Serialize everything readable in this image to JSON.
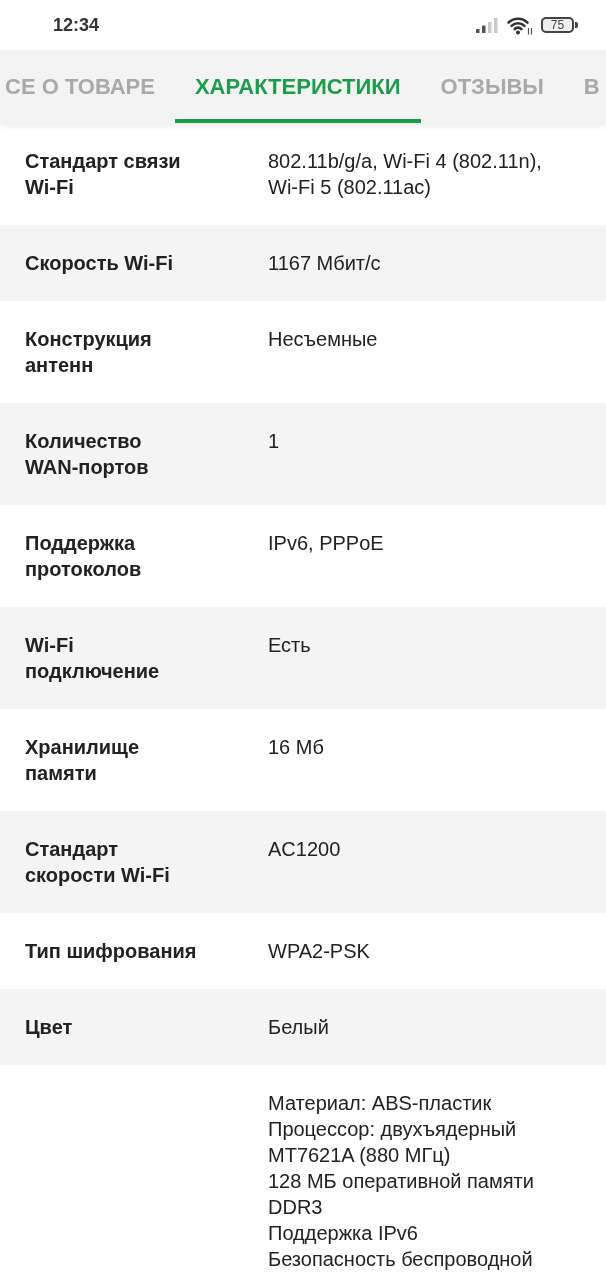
{
  "status_bar": {
    "time": "12:34",
    "battery": "75"
  },
  "tabs": [
    {
      "label": "СЕ О ТОВАРЕ",
      "selected": false
    },
    {
      "label": "ХАРАКТЕРИСТИКИ",
      "selected": true
    },
    {
      "label": "ОТЗЫВЫ",
      "selected": false
    },
    {
      "label": "В",
      "selected": false
    }
  ],
  "specs": [
    {
      "name": "Стандарт связи Wi-Fi",
      "lines": [
        "802.11b/g/a, Wi-Fi 4 (802.11n), Wi-Fi 5 (802.11ac)"
      ]
    },
    {
      "name": "Скорость Wi-Fi",
      "lines": [
        "1167 Мбит/с"
      ]
    },
    {
      "name": "Конструкция антенн",
      "lines": [
        "Несъемные"
      ]
    },
    {
      "name": "Количество WAN-портов",
      "lines": [
        "1"
      ]
    },
    {
      "name": "Поддержка протоколов",
      "lines": [
        "IPv6, PPPoE"
      ]
    },
    {
      "name": "Wi-Fi подключение",
      "lines": [
        "Есть"
      ]
    },
    {
      "name": "Хранилище памяти",
      "lines": [
        "16 Мб"
      ]
    },
    {
      "name": "Стандарт скорости Wi-Fi",
      "lines": [
        "AC1200"
      ]
    },
    {
      "name": "Тип шифрования",
      "lines": [
        "WPA2-PSK"
      ]
    },
    {
      "name": "Цвет",
      "lines": [
        "Белый"
      ]
    },
    {
      "lines": [
        "Материал: ABS-пластик",
        "Процессор: двухъядерный MT7621A (880 МГц)",
        "128 МБ оперативной памяти DDR3",
        "Поддержка IPv6",
        "Безопасность беспроводной"
      ]
    }
  ]
}
